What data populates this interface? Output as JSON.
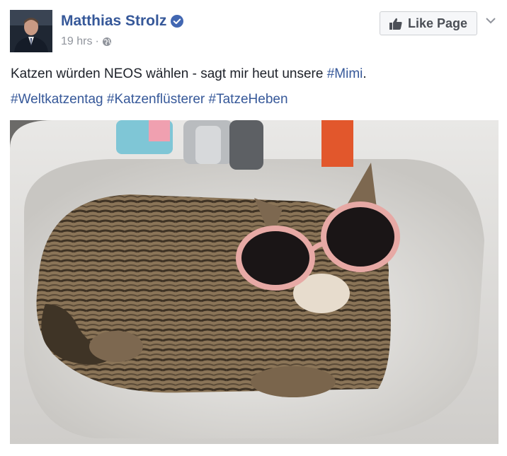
{
  "post": {
    "author": "Matthias Strolz",
    "timestamp": "19 hrs",
    "separator": "·",
    "audience_icon": "globe-icon",
    "verified_icon": "verified-badge-icon",
    "like_page_label": "Like Page",
    "text_main": "Katzen würden NEOS wählen - sagt mir heut unsere ",
    "text_tag": "#Mimi",
    "text_end": ".",
    "hashtags": [
      "#Weltkatzentag",
      "#Katzenflüsterer",
      "#TatzeHeben"
    ]
  },
  "colors": {
    "link": "#365899",
    "text": "#1d2129",
    "meta": "#90949c",
    "verified": "#4267b2"
  }
}
